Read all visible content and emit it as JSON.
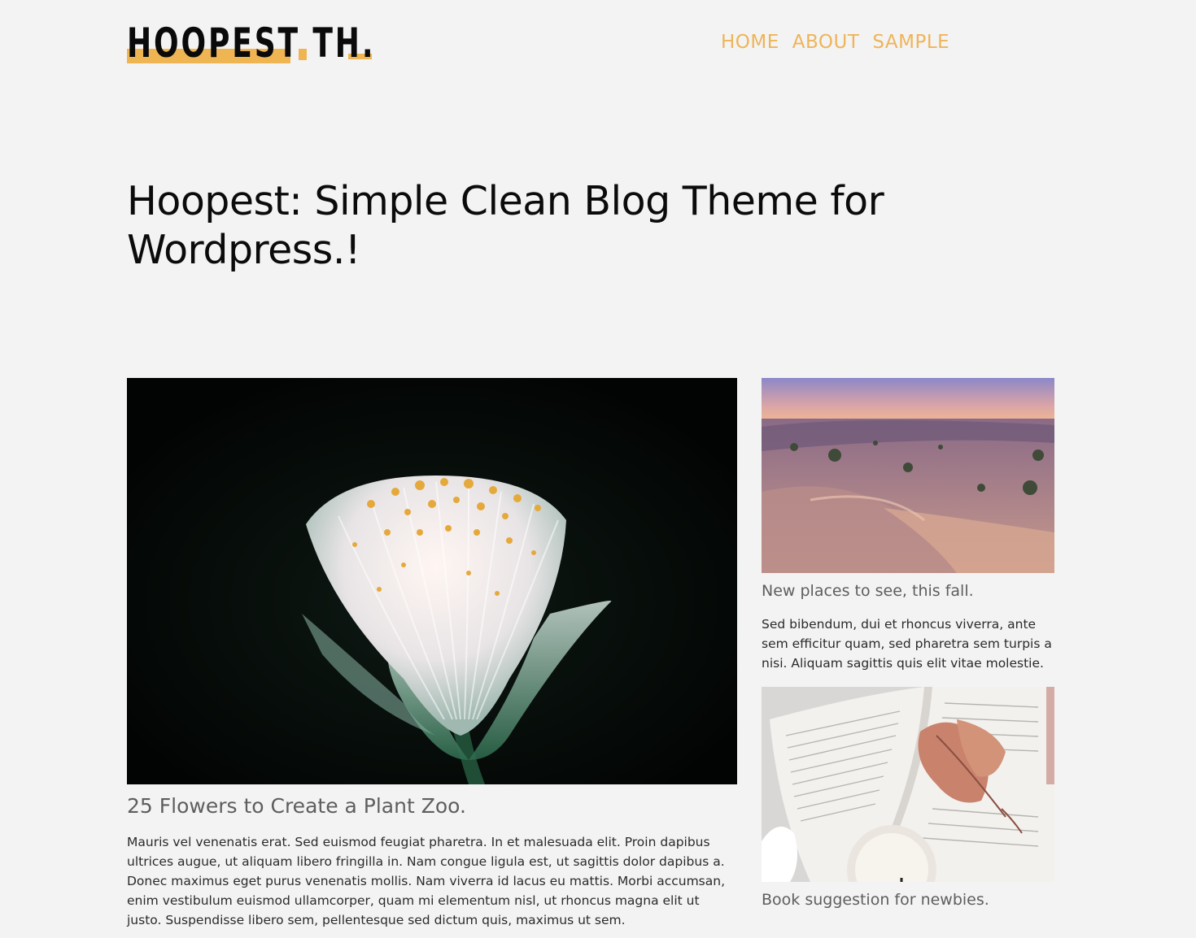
{
  "header": {
    "logo_text": "HOOPEST TH.",
    "nav": [
      {
        "label": "HOME"
      },
      {
        "label": "ABOUT"
      },
      {
        "label": "SAMPLE"
      }
    ]
  },
  "hero": {
    "title": "Hoopest: Simple Clean Blog Theme for Wordpress.!"
  },
  "main_post": {
    "image": "flower-photo",
    "title": "25 Flowers to Create a Plant Zoo.",
    "excerpt": "Mauris vel venenatis erat. Sed euismod feugiat pharetra. In et malesuada elit. Proin dapibus ultrices augue, ut aliquam libero fringilla in. Nam congue ligula est, ut sagittis dolor dapibus a. Donec maximus eget purus venenatis mollis. Nam viverra id lacus eu mattis. Morbi accumsan, enim vestibulum euismod ullamcorper, quam mi elementum nisl, ut rhoncus magna elit ut justo. Suspendisse libero sem, pellentesque sed dictum quis, maximus ut sem."
  },
  "side_posts": [
    {
      "image": "desert-photo",
      "title": "New places to see, this fall.",
      "excerpt": "Sed bibendum, dui et rhoncus viverra, ante sem efficitur quam, sed pharetra sem turpis a nisi. Aliquam sagittis quis elit vitae molestie."
    },
    {
      "image": "book-leaf-photo",
      "title": "Book suggestion for newbies."
    }
  ],
  "colors": {
    "accent": "#eeb45a",
    "logo_highlight": "#f0b553",
    "background": "#f3f3f3"
  }
}
